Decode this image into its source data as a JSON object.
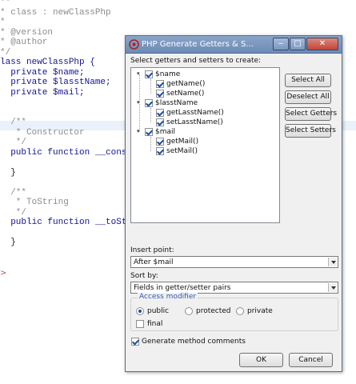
{
  "editor": {
    "lines": [
      {
        "cls": "cmt",
        "text": "**"
      },
      {
        "cls": "cmt",
        "text": "* class : newClassPhp"
      },
      {
        "cls": "cmt",
        "text": "*"
      },
      {
        "cls": "cmt",
        "text": "* @version"
      },
      {
        "cls": "cmt",
        "text": "* @author"
      },
      {
        "cls": "cmt",
        "text": "*/"
      },
      {
        "cls": "kw",
        "text": "lass newClassPhp {"
      },
      {
        "cls": "kw",
        "text": "  private $name;"
      },
      {
        "cls": "kw",
        "text": "  private $lasstName;"
      },
      {
        "cls": "kw",
        "text": "  private $mail;"
      },
      {
        "cls": "plain",
        "text": ""
      },
      {
        "cls": "plain",
        "text": ""
      },
      {
        "cls": "cmt",
        "text": "  /**"
      },
      {
        "cls": "cmt",
        "text": "   * Constructor"
      },
      {
        "cls": "cmt",
        "text": "   */"
      },
      {
        "cls": "kw",
        "text": "  public function __constr"
      },
      {
        "cls": "plain",
        "text": ""
      },
      {
        "cls": "plain",
        "text": "  }"
      },
      {
        "cls": "plain",
        "text": ""
      },
      {
        "cls": "cmt",
        "text": "  /**"
      },
      {
        "cls": "cmt",
        "text": "   * ToString"
      },
      {
        "cls": "cmt",
        "text": "   */"
      },
      {
        "cls": "kw",
        "text": "  public function __toStri"
      },
      {
        "cls": "plain",
        "text": ""
      },
      {
        "cls": "plain",
        "text": "  }"
      }
    ],
    "gutter_mark": ">"
  },
  "dialog": {
    "title": "PHP Generate Getters & S...",
    "title_icon": "php-icon",
    "controls": {
      "minimize": "‒",
      "maximize": "□",
      "close": "✕"
    },
    "instruction": "Select getters and setters to create:",
    "tree": [
      {
        "field": "$name",
        "checked": true,
        "methods": [
          {
            "label": "getName()",
            "checked": true
          },
          {
            "label": "setName()",
            "checked": true
          }
        ]
      },
      {
        "field": "$lasstName",
        "checked": true,
        "methods": [
          {
            "label": "getLasstName()",
            "checked": true
          },
          {
            "label": "setLasstName()",
            "checked": true
          }
        ]
      },
      {
        "field": "$mail",
        "checked": true,
        "methods": [
          {
            "label": "getMail()",
            "checked": true
          },
          {
            "label": "setMail()",
            "checked": true
          }
        ]
      }
    ],
    "buttons": {
      "select_all": "Select All",
      "deselect_all": "Deselect All",
      "select_getters": "Select Getters",
      "select_setters": "Select Setters",
      "ok": "OK",
      "cancel": "Cancel"
    },
    "insert_point": {
      "label": "Insert point:",
      "value": "After $mail"
    },
    "sort_by": {
      "label": "Sort by:",
      "value": "Fields in getter/setter pairs"
    },
    "access_modifier": {
      "legend": "Access modifier",
      "options": [
        {
          "label": "public",
          "selected": true
        },
        {
          "label": "protected",
          "selected": false
        },
        {
          "label": "private",
          "selected": false
        }
      ],
      "final": {
        "label": "final",
        "checked": false
      }
    },
    "generate_comments": {
      "label": "Generate method comments",
      "checked": true
    },
    "colors": {
      "accent": "#2a5db0",
      "titlebar": "#7b97c0"
    }
  }
}
